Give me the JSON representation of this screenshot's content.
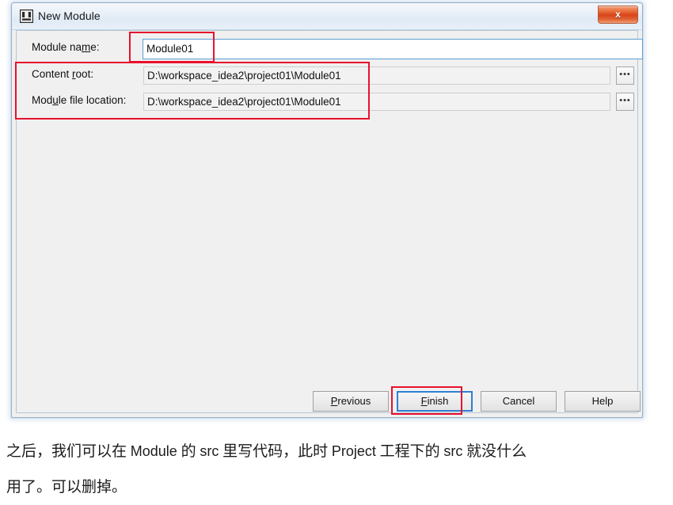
{
  "dialog": {
    "title": "New Module",
    "icon": "intellij-module-icon",
    "close_label": "x",
    "fields": [
      {
        "key": "module_name",
        "label_before": "Module na",
        "label_mnemonic": "m",
        "label_after": "e:",
        "value": "Module01",
        "placeholder": "",
        "has_browse": false,
        "focused": true
      },
      {
        "key": "content_root",
        "label_before": "Content ",
        "label_mnemonic": "r",
        "label_after": "oot:",
        "value": "D:\\workspace_idea2\\project01\\Module01",
        "placeholder": "",
        "has_browse": true,
        "browse_label": "•••",
        "focused": false
      },
      {
        "key": "module_file_location",
        "label_before": "Mod",
        "label_mnemonic": "u",
        "label_after": "le file location:",
        "value": "D:\\workspace_idea2\\project01\\Module01",
        "placeholder": "",
        "has_browse": true,
        "browse_label": "•••",
        "focused": false
      }
    ],
    "buttons": [
      {
        "key": "previous",
        "before": "",
        "mnemonic": "P",
        "after": "revious",
        "focused": false
      },
      {
        "key": "finish",
        "before": "",
        "mnemonic": "F",
        "after": "inish",
        "focused": true
      },
      {
        "key": "cancel",
        "before": "Cancel",
        "mnemonic": "",
        "after": "",
        "focused": false
      },
      {
        "key": "help",
        "before": "Help",
        "mnemonic": "",
        "after": "",
        "focused": false
      }
    ]
  },
  "annotations": {
    "color": "#e8112d",
    "boxes": [
      {
        "name": "module-name-highlight"
      },
      {
        "name": "paths-highlight"
      },
      {
        "name": "finish-highlight"
      }
    ]
  },
  "caption": {
    "line1_part1": "之后，我们可以在 ",
    "line1_latin1": "Module",
    "line1_part2": " 的 ",
    "line1_latin2": "src",
    "line1_part3": " 里写代码，此时 ",
    "line1_latin3": "Project",
    "line1_part4": " 工程下的 ",
    "line1_latin4": "src",
    "line1_part5": " 就没什么",
    "line2": "用了。可以删掉。"
  },
  "colors": {
    "dialog_background": "#f0f0f0",
    "titlebar_gradient_top": "#f4f8fc",
    "titlebar_gradient_bottom": "#e9f1f8",
    "focus_border": "#5a9fd4",
    "button_focus_border": "#2f7fd0",
    "annotation_red": "#e8112d",
    "close_button_red": "#d9441a"
  }
}
